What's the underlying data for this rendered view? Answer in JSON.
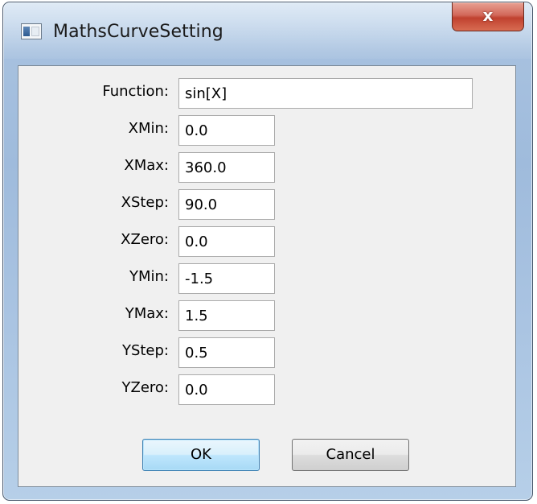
{
  "window": {
    "title": "MathsCurveSetting",
    "close_label": "x"
  },
  "form": {
    "fields": [
      {
        "label": "Function:",
        "value": "sin[X]"
      },
      {
        "label": "XMin:",
        "value": "0.0"
      },
      {
        "label": "XMax:",
        "value": "360.0"
      },
      {
        "label": "XStep:",
        "value": "90.0"
      },
      {
        "label": "XZero:",
        "value": "0.0"
      },
      {
        "label": "YMin:",
        "value": "-1.5"
      },
      {
        "label": "YMax:",
        "value": "1.5"
      },
      {
        "label": "YStep:",
        "value": "0.5"
      },
      {
        "label": "YZero:",
        "value": "0.0"
      }
    ]
  },
  "buttons": {
    "ok_label": "OK",
    "cancel_label": "Cancel"
  },
  "colors": {
    "frame_blue": "#a7c1df",
    "close_red": "#c0412f",
    "default_button_blue": "#3c7fb1"
  }
}
